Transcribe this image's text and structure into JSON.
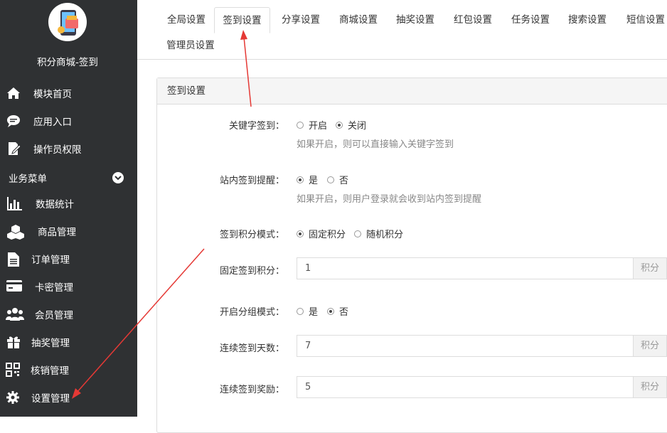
{
  "app": {
    "title": "积分商城-签到"
  },
  "sidebar": {
    "items": [
      {
        "label": "模块首页",
        "icon": "home-icon"
      },
      {
        "label": "应用入口",
        "icon": "chat-bubble-icon"
      },
      {
        "label": "操作员权限",
        "icon": "edit-document-icon"
      }
    ],
    "section": {
      "label": "业务菜单",
      "icon": "chevron-down-icon"
    },
    "menu": [
      {
        "label": "数据统计",
        "icon": "bar-chart-icon"
      },
      {
        "label": "商品管理",
        "icon": "cubes-icon"
      },
      {
        "label": "订单管理",
        "icon": "document-icon"
      },
      {
        "label": "卡密管理",
        "icon": "credit-card-icon"
      },
      {
        "label": "会员管理",
        "icon": "users-icon"
      },
      {
        "label": "抽奖管理",
        "icon": "gift-icon"
      },
      {
        "label": "核销管理",
        "icon": "qrcode-icon"
      },
      {
        "label": "设置管理",
        "icon": "gear-icon"
      }
    ]
  },
  "tabs": [
    "全局设置",
    "签到设置",
    "分享设置",
    "商城设置",
    "抽奖设置",
    "红包设置",
    "任务设置",
    "搜索设置",
    "短信设置",
    "管理员设置"
  ],
  "active_tab": "签到设置",
  "panel": {
    "title": "签到设置"
  },
  "form": {
    "keyword_signin": {
      "label": "关键字签到：",
      "options": [
        "开启",
        "关闭"
      ],
      "selected": "关闭",
      "help": "如果开启，则可以直接输入关键字签到"
    },
    "site_reminder": {
      "label": "站内签到提醒：",
      "options": [
        "是",
        "否"
      ],
      "selected": "是",
      "help": "如果开启，则用户登录就会收到站内签到提醒"
    },
    "points_mode": {
      "label": "签到积分模式：",
      "options": [
        "固定积分",
        "随机积分"
      ],
      "selected": "固定积分"
    },
    "fixed_points": {
      "label": "固定签到积分：",
      "value": "1",
      "addon": "积分"
    },
    "group_mode": {
      "label": "开启分组模式：",
      "options": [
        "是",
        "否"
      ],
      "selected": "否"
    },
    "consecutive_days": {
      "label": "连续签到天数：",
      "value": "7",
      "addon": "积分"
    },
    "consecutive_reward": {
      "label": "连续签到奖励：",
      "value": "5",
      "addon": "积分"
    }
  },
  "colors": {
    "sidebar_bg": "#2f3133",
    "annotation_arrow": "#e53935"
  }
}
